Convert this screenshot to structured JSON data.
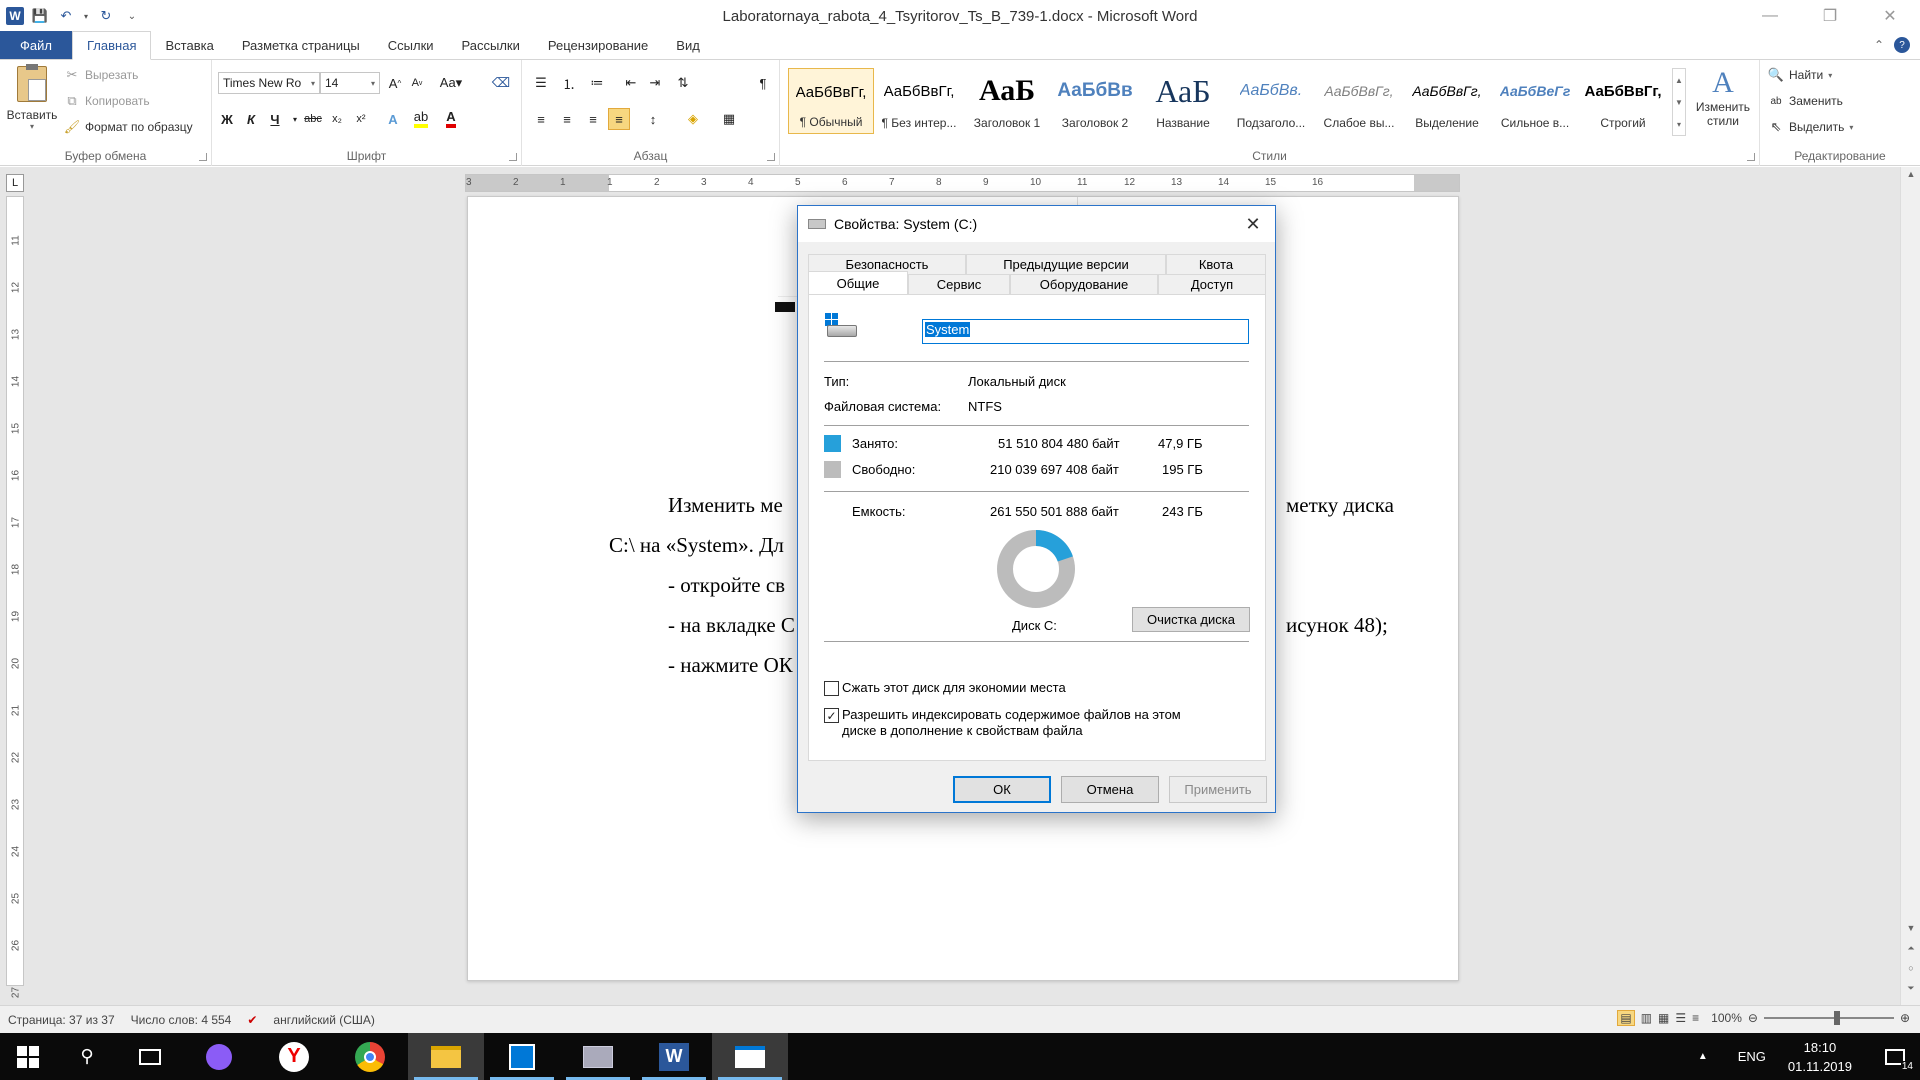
{
  "window": {
    "title": "Laboratornaya_rabota_4_Tsyritorov_Ts_B_739-1.docx - Microsoft Word"
  },
  "ribbon_tabs": [
    "Файл",
    "Главная",
    "Вставка",
    "Разметка страницы",
    "Ссылки",
    "Рассылки",
    "Рецензирование",
    "Вид"
  ],
  "clipboard": {
    "paste_label": "Вставить",
    "cut_label": "Вырезать",
    "copy_label": "Копировать",
    "format_painter_label": "Формат по образцу",
    "group_label": "Буфер обмена"
  },
  "font": {
    "family": "Times New Ro",
    "size": "14",
    "group_label": "Шрифт"
  },
  "paragraph": {
    "group_label": "Абзац"
  },
  "styles": {
    "group_label": "Стили",
    "change_styles_label": "Изменить стили",
    "items": [
      {
        "sample": "АаБбВвГг,",
        "name": "¶ Обычный",
        "selected": true
      },
      {
        "sample": "АаБбВвГг,",
        "name": "¶ Без интер..."
      },
      {
        "sample": "АаБ",
        "name": "Заголовок 1"
      },
      {
        "sample": "АаБбВв",
        "name": "Заголовок 2"
      },
      {
        "sample": "АаБ",
        "name": "Название"
      },
      {
        "sample": "АаБбВв.",
        "name": "Подзаголо..."
      },
      {
        "sample": "АаБбВвГг,",
        "name": "Слабое вы..."
      },
      {
        "sample": "АаБбВвГг,",
        "name": "Выделение"
      },
      {
        "sample": "АаБбВеГг",
        "name": "Сильное в..."
      },
      {
        "sample": "АаБбВвГг,",
        "name": "Строгий"
      }
    ]
  },
  "editing": {
    "group_label": "Редактирование",
    "find_label": "Найти",
    "replace_label": "Заменить",
    "select_label": "Выделить"
  },
  "ruler": {
    "h_numbers": [
      "3",
      "2",
      "1",
      "1",
      "2",
      "3",
      "4",
      "5",
      "6",
      "7",
      "8",
      "9",
      "10",
      "11",
      "12",
      "13",
      "14",
      "15",
      "16"
    ],
    "v_numbers": [
      "11",
      "12",
      "13",
      "14",
      "15",
      "16",
      "17",
      "18",
      "19",
      "20",
      "21",
      "22",
      "23",
      "24",
      "25",
      "26",
      "27"
    ]
  },
  "document": {
    "line1_left": "Изменить  ме",
    "line1_right": "метку  диска",
    "line2": "C:\\ на «System». Дл",
    "line3": "- откройте св",
    "line4_left": "- на вкладке С",
    "line4_right": "исунок 48);",
    "line5": "- нажмите ОК"
  },
  "dialog": {
    "title": "Свойства: System (C:)",
    "tabs_row1": [
      "Безопасность",
      "Предыдущие версии",
      "Квота"
    ],
    "tabs_row2": [
      "Общие",
      "Сервис",
      "Оборудование",
      "Доступ"
    ],
    "drive_name": "System",
    "type_label": "Тип:",
    "type_value": "Локальный диск",
    "fs_label": "Файловая система:",
    "fs_value": "NTFS",
    "used_label": "Занято:",
    "used_bytes": "51 510 804 480 байт",
    "used_gb": "47,9 ГБ",
    "free_label": "Свободно:",
    "free_bytes": "210 039 697 408 байт",
    "free_gb": "195 ГБ",
    "capacity_label": "Емкость:",
    "capacity_bytes": "261 550 501 888 байт",
    "capacity_gb": "243 ГБ",
    "disk_caption": "Диск C:",
    "cleanup_button": "Очистка диска",
    "compress_label": "Сжать этот диск для экономии места",
    "compress_checked": false,
    "index_label_line1": "Разрешить индексировать содержимое файлов на этом",
    "index_label_line2": "диске в дополнение к свойствам файла",
    "index_checked": true,
    "ok_button": "ОК",
    "cancel_button": "Отмена",
    "apply_button": "Применить",
    "used_fraction": 0.197,
    "used_color": "#26a0da",
    "free_color": "#bcbcbc"
  },
  "statusbar": {
    "page": "Страница: 37 из 37",
    "words": "Число слов: 4 554",
    "language": "английский (США)",
    "zoom": "100%"
  },
  "taskbar": {
    "lang": "ENG",
    "time": "18:10",
    "date": "01.11.2019",
    "notifications": "14"
  }
}
